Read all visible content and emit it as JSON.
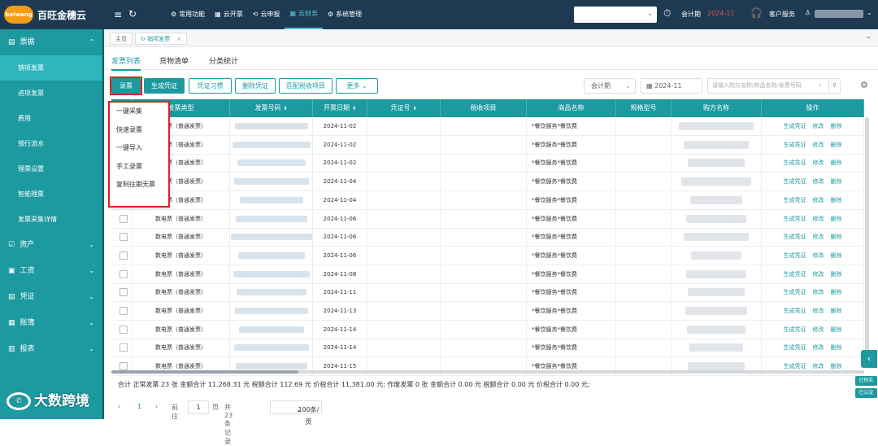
{
  "app": {
    "logo_text": "baiwang",
    "brand": "百旺金穗云"
  },
  "topnav": [
    {
      "icon": "⚙",
      "label": "常用功能"
    },
    {
      "icon": "▦",
      "label": "云开票"
    },
    {
      "icon": "⟲",
      "label": "云申报"
    },
    {
      "icon": "▦",
      "label": "云财务",
      "active": true
    },
    {
      "icon": "⚙",
      "label": "系统管理"
    }
  ],
  "header": {
    "period_label": "会计期",
    "period_value": "2024-11",
    "customer_service": "客户服务"
  },
  "sidebar": {
    "groups": [
      {
        "icon": "▤",
        "label": "票据",
        "expanded": true,
        "items": [
          "销项发票",
          "进项发票",
          "费用",
          "银行流水",
          "理票设置",
          "智能理票",
          "发票采集详情"
        ]
      },
      {
        "icon": "☑",
        "label": "资产"
      },
      {
        "icon": "▣",
        "label": "工资"
      },
      {
        "icon": "▤",
        "label": "凭证"
      },
      {
        "icon": "▦",
        "label": "账簿"
      },
      {
        "icon": "▥",
        "label": "报表"
      }
    ]
  },
  "tabs": {
    "home": "主页",
    "current": "销项发票"
  },
  "subtabs": [
    "发票列表",
    "货物清单",
    "分类统计"
  ],
  "toolbar": {
    "buttons": [
      "录票",
      "生成凭证",
      "凭证习惯",
      "删除凭证",
      "匹配税收项目",
      "更多"
    ],
    "period_select": "会计期",
    "date": "2024-11",
    "search_placeholder": "请输入购方名称/商品名称/发票号码"
  },
  "dropdown": [
    "一键采集",
    "快速录票",
    "一键导入",
    "手工录票",
    "复制往期无票"
  ],
  "table": {
    "columns": [
      "",
      "发票类型",
      "发票号码",
      "开票日期",
      "凭证号",
      "税收项目",
      "商品名称",
      "规格型号",
      "购方名称",
      "操作"
    ],
    "rows": [
      {
        "type": "数电票（普通发票）",
        "date": "2024-11-02",
        "goods": "*餐饮服务*餐饮费"
      },
      {
        "type": "数电票（普通发票）",
        "date": "2024-11-02",
        "goods": "*餐饮服务*餐饮费"
      },
      {
        "type": "数电票（普通发票）",
        "date": "2024-11-02",
        "goods": "*餐饮服务*餐饮费"
      },
      {
        "type": "数电票（普通发票）",
        "date": "2024-11-04",
        "goods": "*餐饮服务*餐饮费"
      },
      {
        "type": "数电票（普通发票）",
        "date": "2024-11-04",
        "goods": "*餐饮服务*餐饮费"
      },
      {
        "type": "数电票（普通发票）",
        "date": "2024-11-06",
        "goods": "*餐饮服务*餐饮费"
      },
      {
        "type": "数电票（普通发票）",
        "date": "2024-11-06",
        "goods": "*餐饮服务*餐饮费"
      },
      {
        "type": "数电票（普通发票）",
        "date": "2024-11-06",
        "goods": "*餐饮服务*餐饮费"
      },
      {
        "type": "数电票（普通发票）",
        "date": "2024-11-08",
        "goods": "*餐饮服务*餐饮费"
      },
      {
        "type": "数电票（普通发票）",
        "date": "2024-11-11",
        "goods": "*餐饮服务*餐饮费"
      },
      {
        "type": "数电票（普通发票）",
        "date": "2024-11-13",
        "goods": "*餐饮服务*餐饮费"
      },
      {
        "type": "数电票（普通发票）",
        "date": "2024-11-14",
        "goods": "*餐饮服务*餐饮费"
      },
      {
        "type": "数电票（普通发票）",
        "date": "2024-11-14",
        "goods": "*餐饮服务*餐饮费"
      },
      {
        "type": "数电票（普通发票）",
        "date": "2024-11-15",
        "goods": "*餐饮服务*餐饮费"
      }
    ],
    "ops": [
      "生成凭证",
      "修改",
      "删除"
    ]
  },
  "summary": "合计 正常发票 23 张 金额合计 11,268.31 元 税额合计 112.69 元 价税合计 11,381.00 元; 作废发票 0 张 金额合计 0.00 元 税额合计 0.00 元 价税合计 0.00 元;",
  "pager": {
    "current": "1",
    "goto_label": "前往",
    "goto_value": "1",
    "page_unit": "页",
    "total": "共 23 条记录",
    "size": "100条/页"
  },
  "side_buttons": [
    "已核实",
    "已认证"
  ],
  "watermark": "大数跨境",
  "colors": {
    "teal": "#1c9aa0",
    "topbar": "#1e3a52",
    "highlight_red": "#e02020"
  }
}
